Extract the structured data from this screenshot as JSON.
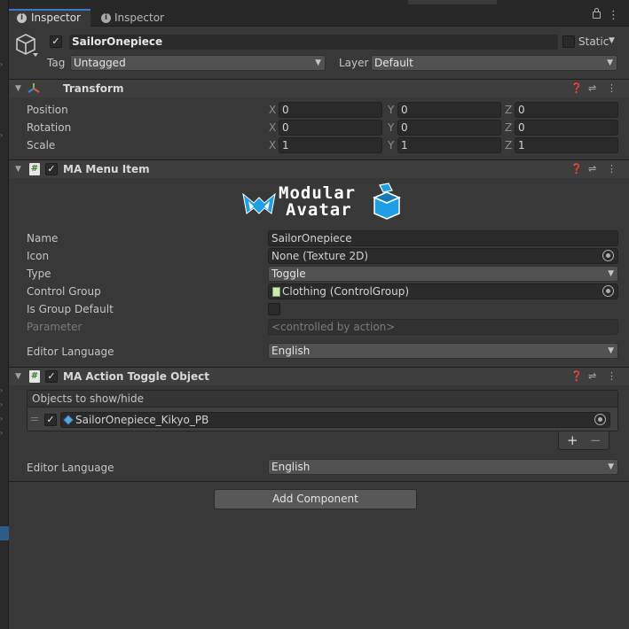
{
  "tabs": [
    {
      "label": "Inspector"
    },
    {
      "label": "Inspector"
    }
  ],
  "object": {
    "name": "SailorOnepiece",
    "static_label": "Static",
    "tag_label": "Tag",
    "tag_value": "Untagged",
    "layer_label": "Layer",
    "layer_value": "Default"
  },
  "transform": {
    "title": "Transform",
    "rows": [
      {
        "label": "Position",
        "x": "0",
        "y": "0",
        "z": "0"
      },
      {
        "label": "Rotation",
        "x": "0",
        "y": "0",
        "z": "0"
      },
      {
        "label": "Scale",
        "x": "1",
        "y": "1",
        "z": "1"
      }
    ],
    "axes": {
      "x": "X",
      "y": "Y",
      "z": "Z"
    }
  },
  "menu_item": {
    "title": "MA Menu Item",
    "logo_line1": "Modular",
    "logo_line2": "Avatar",
    "name_label": "Name",
    "name_value": "SailorOnepiece",
    "icon_label": "Icon",
    "icon_value": "None (Texture 2D)",
    "type_label": "Type",
    "type_value": "Toggle",
    "control_group_label": "Control Group",
    "control_group_value": "Clothing (ControlGroup)",
    "is_group_default_label": "Is Group Default",
    "parameter_label": "Parameter",
    "parameter_placeholder": "<controlled by action>",
    "editor_language_label": "Editor Language",
    "editor_language_value": "English"
  },
  "toggle_object": {
    "title": "MA Action Toggle Object",
    "list_header": "Objects to show/hide",
    "items": [
      {
        "name": "SailorOnepiece_Kikyo_PB"
      }
    ],
    "add_symbol": "+",
    "remove_symbol": "−",
    "editor_language_label": "Editor Language",
    "editor_language_value": "English"
  },
  "add_component_label": "Add Component",
  "colors": {
    "panel_bg": "#383838",
    "header_bg": "#3e3e3e",
    "field_bg": "#2a2a2a",
    "dropdown_bg": "#515151",
    "logo_blue": "#1f9ee6",
    "logo_white": "#ffffff",
    "selection_blue": "#2c5d87"
  }
}
